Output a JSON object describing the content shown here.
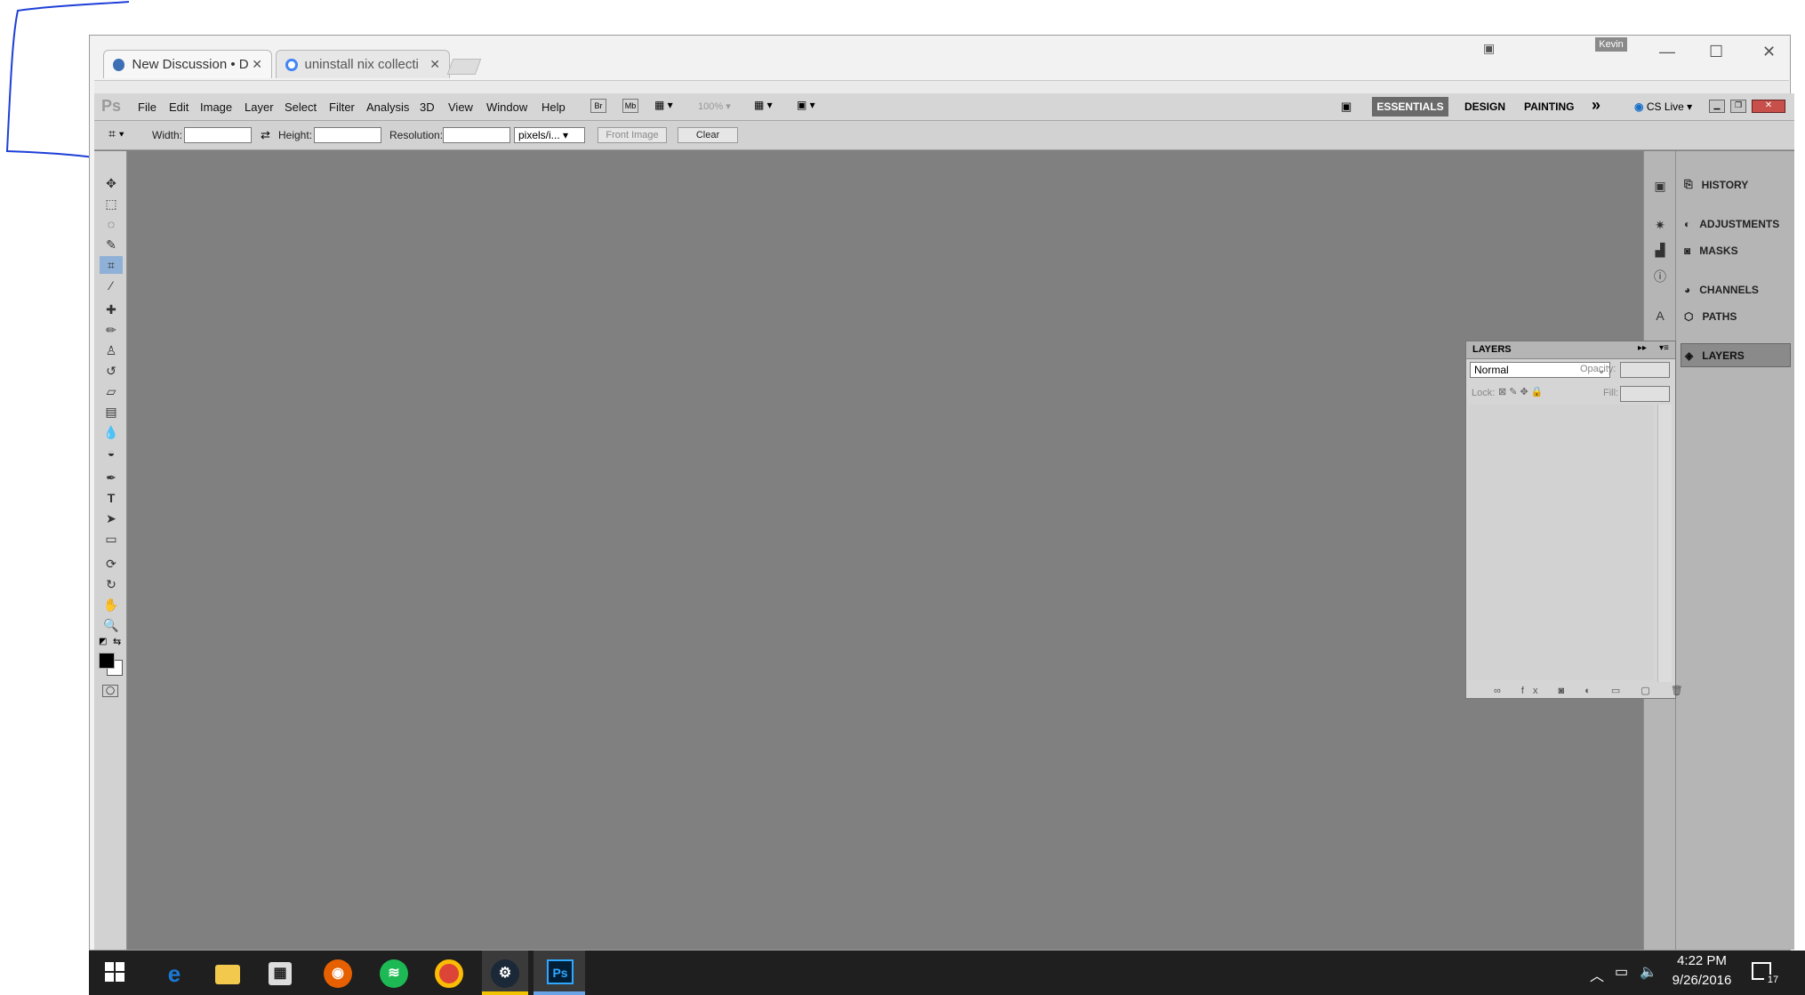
{
  "browser": {
    "tabs": [
      {
        "label": "New Discussion • D"
      },
      {
        "label": "uninstall nix collecti"
      }
    ],
    "user_badge": "Kevin"
  },
  "ps": {
    "logo": "Ps",
    "menus": [
      "File",
      "Edit",
      "Image",
      "Layer",
      "Select",
      "Filter",
      "Analysis",
      "3D",
      "View",
      "Window",
      "Help"
    ],
    "zoom": "100%",
    "workspaces": [
      "ESSENTIALS",
      "DESIGN",
      "PAINTING"
    ],
    "workspace_more": "»",
    "cs_live": "CS Live",
    "options": {
      "width_label": "Width:",
      "height_label": "Height:",
      "resolution_label": "Resolution:",
      "units": "pixels/i...",
      "front_image": "Front Image",
      "clear": "Clear"
    },
    "panels": [
      "HISTORY",
      "ADJUSTMENTS",
      "MASKS",
      "CHANNELS",
      "PATHS",
      "LAYERS"
    ],
    "layers_panel": {
      "title": "LAYERS",
      "blend_mode": "Normal",
      "opacity_label": "Opacity:",
      "lock_label": "Lock:",
      "fill_label": "Fill:"
    }
  },
  "taskbar": {
    "time": "4:22 PM",
    "date": "9/26/2016",
    "notifications": "17"
  }
}
